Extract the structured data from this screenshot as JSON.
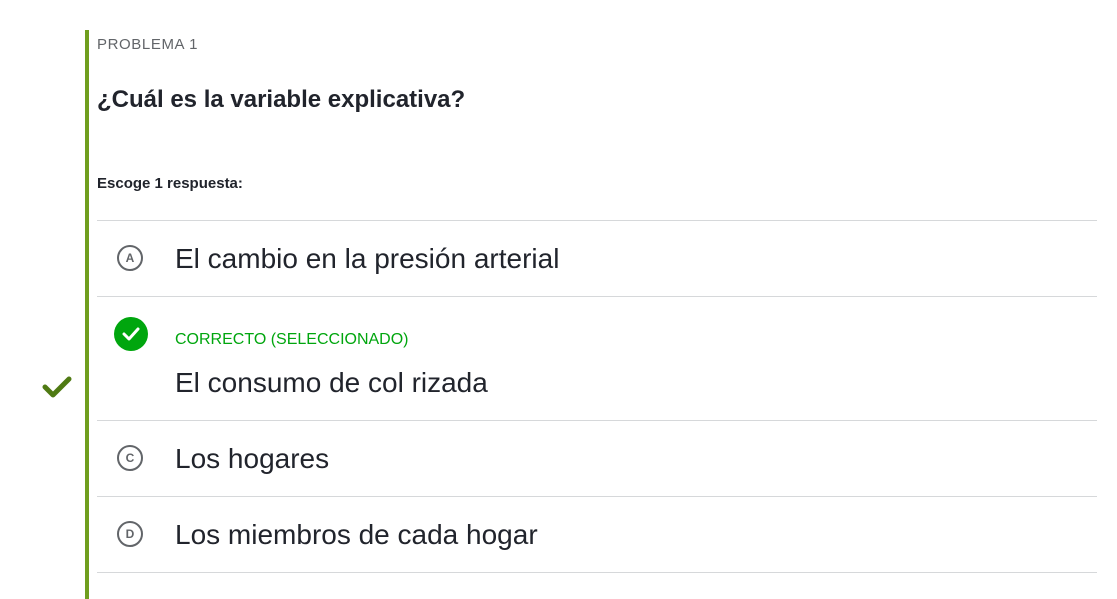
{
  "problem": {
    "label": "PROBLEMA 1",
    "question": "¿Cuál es la variable explicativa?",
    "instruction": "Escoge 1 respuesta:"
  },
  "choices": [
    {
      "letter": "A",
      "text": "El cambio en la presión arterial"
    },
    {
      "status": "CORRECTO (SELECCIONADO)",
      "text": "El consumo de col rizada"
    },
    {
      "letter": "C",
      "text": "Los hogares"
    },
    {
      "letter": "D",
      "text": "Los miembros de cada hogar"
    }
  ],
  "colors": {
    "accent_bar": "#6f9e1e",
    "correct": "#00a60e",
    "left_check": "#4f7a13"
  },
  "icons": {
    "left_marker": "checkmark-icon",
    "correct_badge": "check-circle-icon"
  }
}
